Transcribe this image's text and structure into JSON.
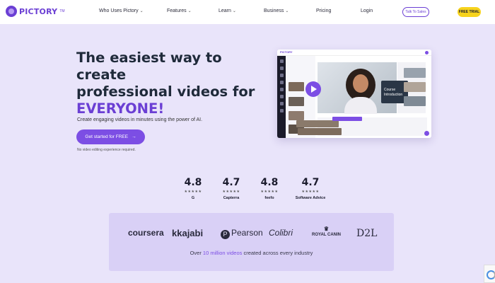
{
  "brand": {
    "name": "PICTORY",
    "tm": "TM"
  },
  "nav": {
    "items": [
      {
        "label": "Who Uses Pictory",
        "chevron": "⌄"
      },
      {
        "label": "Features",
        "chevron": "⌄"
      },
      {
        "label": "Learn",
        "chevron": "⌄"
      },
      {
        "label": "Business",
        "chevron": "⌄"
      },
      {
        "label": "Pricing",
        "chevron": ""
      },
      {
        "label": "Login",
        "chevron": ""
      }
    ],
    "talk_label": "Talk To Sales",
    "trial_label": "FREE TRIAL"
  },
  "hero": {
    "title_line1": "The easiest way to create",
    "title_line2": "professional videos for",
    "title_accent": "EVERYONE!",
    "subtitle": "Create engaging videos in minutes using the power of AI.",
    "cta_label": "Get started for FREE",
    "cta_arrow": "→",
    "note": "No video editing experience required."
  },
  "mockup": {
    "brand": "PICTORY",
    "course_line1": "Course",
    "course_line2": "Introduction"
  },
  "ratings": [
    {
      "score": "4.8",
      "stars": "★★★★★",
      "source": "G"
    },
    {
      "score": "4.7",
      "stars": "★★★★★",
      "source": "Capterra"
    },
    {
      "score": "4.8",
      "stars": "★★★★★",
      "source": "feefo"
    },
    {
      "score": "4.7",
      "stars": "★★★★★",
      "source": "Software Advice"
    }
  ],
  "logos": {
    "coursera": "coursera",
    "kajabi": "kajabi",
    "pearson": "Pearson",
    "pearson_mark": "P",
    "colibri": "Colibri",
    "royal_canin": "ROYAL CANIN",
    "d2l": "D2L"
  },
  "caption": {
    "prefix": "Over ",
    "highlight": "10 million videos",
    "suffix": " created across every industry"
  },
  "colors": {
    "accent": "#7c4ee4",
    "background": "#e9e4fa",
    "trial": "#f7d31c"
  }
}
